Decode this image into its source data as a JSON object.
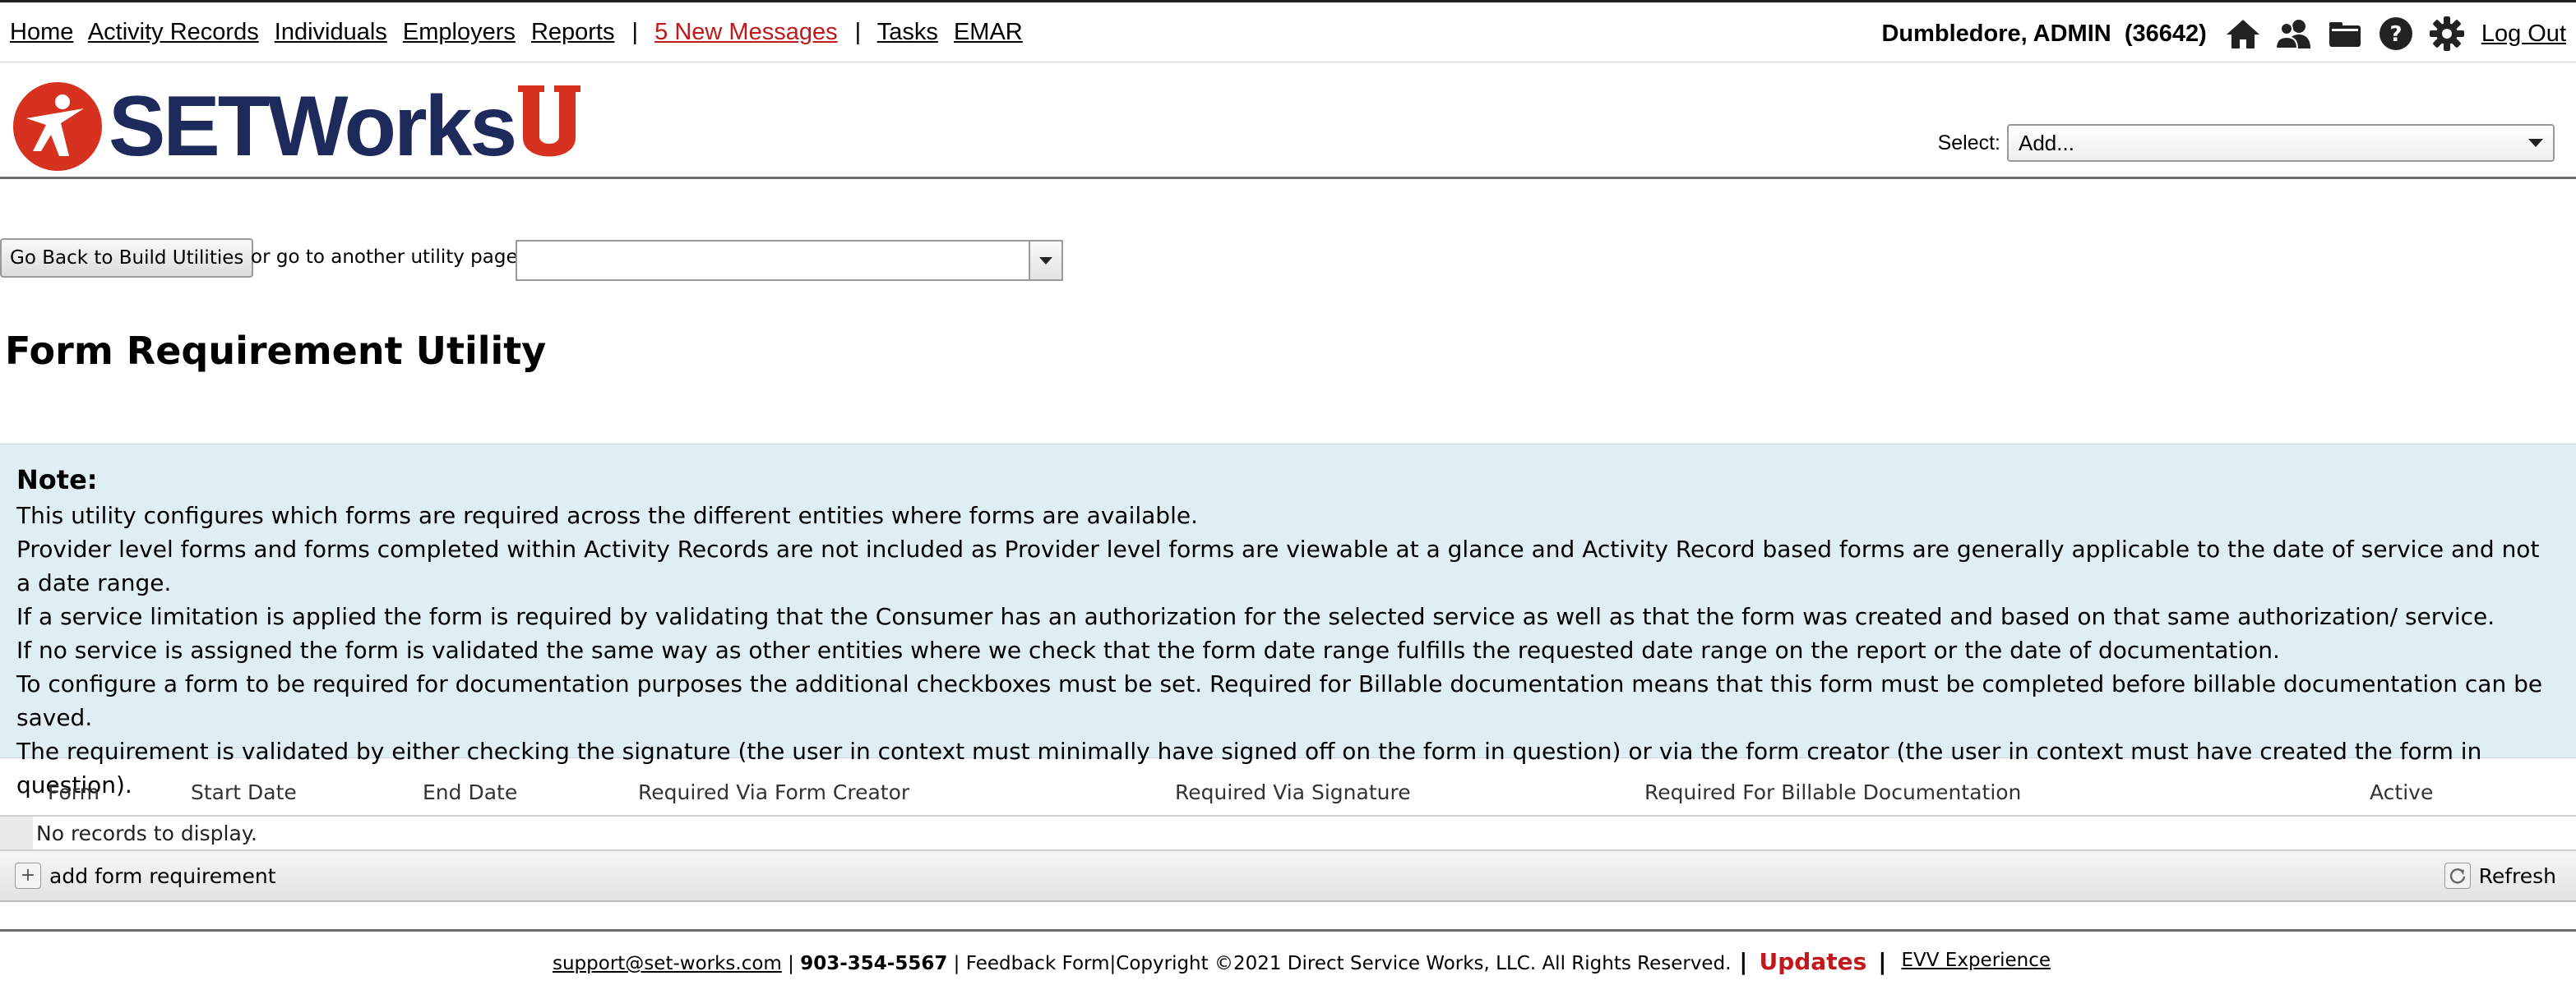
{
  "nav": {
    "home": "Home",
    "activity_records": "Activity Records",
    "individuals": "Individuals",
    "employers": "Employers",
    "reports": "Reports",
    "separator": "|",
    "new_messages": "5 New Messages",
    "tasks": "Tasks",
    "emar": "EMAR"
  },
  "user": {
    "name": "Dumbledore, ADMIN",
    "id": "(36642)",
    "logout": "Log Out",
    "icons": [
      "home-icon",
      "users-icon",
      "folder-icon",
      "help-icon",
      "gear-icon"
    ]
  },
  "header": {
    "logo_text": "SETWorks",
    "select_label": "Select:",
    "select_value": "Add..."
  },
  "utility_nav": {
    "back_button": "Go Back to Build Utilities",
    "or_text": "or go to another utility page:",
    "combo_value": ""
  },
  "page_title": "Form Requirement Utility",
  "note": {
    "heading": "Note:",
    "lines": [
      "This utility configures which forms are required across the different entities where forms are available.",
      "Provider level forms and forms completed within Activity Records are not included as Provider level forms are viewable at a glance and Activity Record based forms are generally applicable to the date of service and not a date range.",
      "If a service limitation is applied the form is required by validating that the Consumer has an authorization for the selected service as well as that the form was created and based on that same authorization/ service.",
      "If no service is assigned the form is validated the same way as other entities where we check that the form date range fulfills the requested date range on the report or the date of documentation.",
      "To configure a form to be required for documentation purposes the additional checkboxes must be set. Required for Billable documentation means that this form must be completed before billable documentation can be saved.",
      "The requirement is validated by either checking the signature (the user in context must minimally have signed off on the form in question) or via the form creator (the user in context must have created the form in question)."
    ]
  },
  "grid": {
    "columns": [
      "Form",
      "Start Date",
      "End Date",
      "Required Via Form Creator",
      "Required Via Signature",
      "Required For Billable Documentation",
      "Active"
    ],
    "empty_text": "No records to display.",
    "add_label": "add form requirement",
    "refresh_label": "Refresh"
  },
  "footer": {
    "email": "support@set-works.com",
    "sep1": "|",
    "phone": "903-354-5567",
    "sep2": "|",
    "feedback": "Feedback Form",
    "sep3": "|",
    "copyright": "Copyright ©2021 Direct Service Works, LLC. All Rights Reserved.",
    "sep4": "|",
    "updates": "Updates",
    "sep5": "|",
    "evv": "EVV Experience"
  },
  "colors": {
    "brand_navy": "#1f2a5c",
    "brand_red": "#d6321f",
    "link_red": "#c0181b",
    "note_bg": "#deeef2"
  }
}
